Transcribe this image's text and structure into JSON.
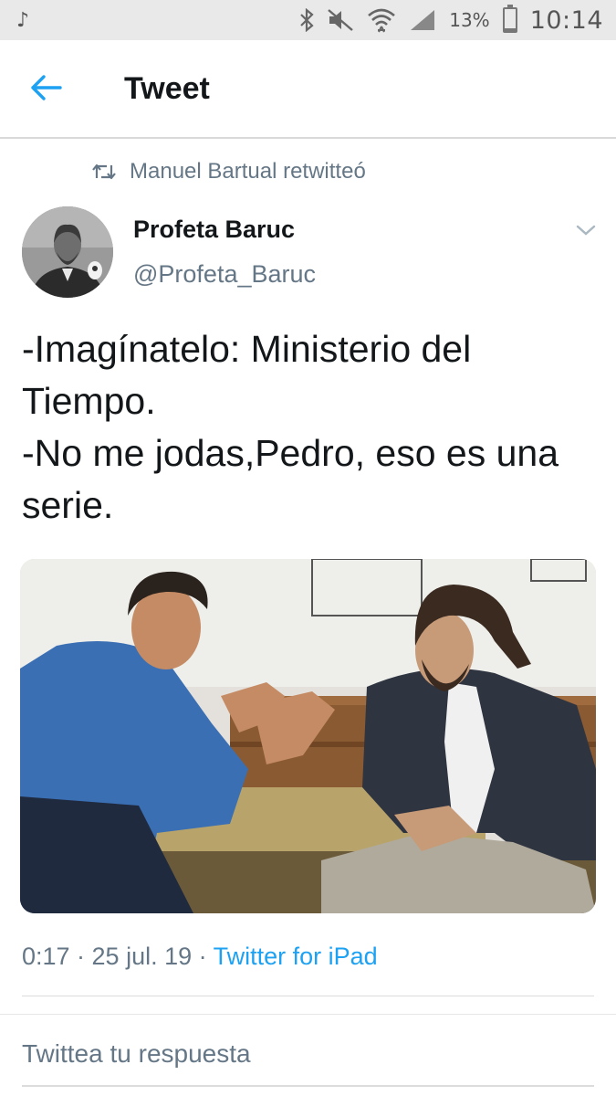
{
  "status_bar": {
    "left_icon": "tiktok-icon",
    "icons": [
      "bluetooth-icon",
      "mute-icon",
      "wifi-icon",
      "signal-icon"
    ],
    "battery_percent": "13%",
    "battery_level": 0.13,
    "time": "10:14"
  },
  "header": {
    "back_icon": "back-arrow-icon",
    "title": "Tweet"
  },
  "tweet": {
    "retweet_context": "Manuel Bartual retwitteó",
    "author_name": "Profeta Baruc",
    "author_handle": "@Profeta_Baruc",
    "text": "-Imagínatelo: Ministerio del Tiempo.\n-No me jodas,Pedro, eso es una serie.",
    "timestamp": "0:17 · 25 jul. 19 · ",
    "source": "Twitter for iPad"
  },
  "reply": {
    "placeholder": "Twittea tu respuesta"
  },
  "colors": {
    "accent": "#1da1f2",
    "secondary_text": "#657786",
    "primary_text": "#14171a"
  }
}
